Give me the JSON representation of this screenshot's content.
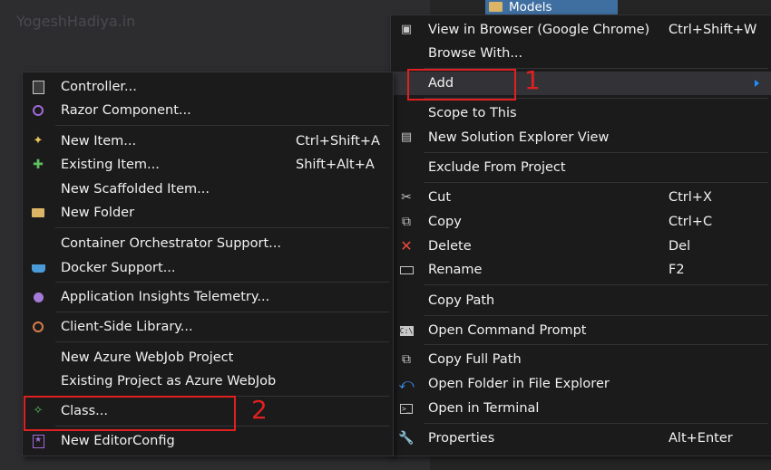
{
  "watermark": "YogeshHadiya.in",
  "solution_explorer": {
    "selected_item": "Models"
  },
  "context_menu": {
    "items": [
      {
        "label": "View in Browser (Google Chrome)",
        "shortcut": "Ctrl+Shift+W",
        "icon": "browser-icon"
      },
      {
        "label": "Browse With...",
        "shortcut": "",
        "icon": ""
      },
      {
        "label": "Add",
        "shortcut": "",
        "icon": "",
        "submenu": true
      },
      {
        "label": "Scope to This",
        "shortcut": "",
        "icon": ""
      },
      {
        "label": "New Solution Explorer View",
        "shortcut": "",
        "icon": "solution-explorer-icon"
      },
      {
        "label": "Exclude From Project",
        "shortcut": "",
        "icon": ""
      },
      {
        "label": "Cut",
        "shortcut": "Ctrl+X",
        "icon": "scissors-icon"
      },
      {
        "label": "Copy",
        "shortcut": "Ctrl+C",
        "icon": "copy-icon"
      },
      {
        "label": "Delete",
        "shortcut": "Del",
        "icon": "delete-icon"
      },
      {
        "label": "Rename",
        "shortcut": "F2",
        "icon": "rename-icon"
      },
      {
        "label": "Copy Path",
        "shortcut": "",
        "icon": ""
      },
      {
        "label": "Open Command Prompt",
        "shortcut": "",
        "icon": "command-prompt-icon"
      },
      {
        "label": "Copy Full Path",
        "shortcut": "",
        "icon": ""
      },
      {
        "label": "Open Folder in File Explorer",
        "shortcut": "",
        "icon": "refresh-arrow-icon"
      },
      {
        "label": "Open in Terminal",
        "shortcut": "",
        "icon": "terminal-icon"
      },
      {
        "label": "Properties",
        "shortcut": "Alt+Enter",
        "icon": "wrench-icon"
      }
    ]
  },
  "add_submenu": {
    "items": [
      {
        "label": "Controller...",
        "shortcut": "",
        "icon": "controller-icon"
      },
      {
        "label": "Razor Component...",
        "shortcut": "",
        "icon": "razor-icon"
      },
      {
        "label": "New Item...",
        "shortcut": "Ctrl+Shift+A",
        "icon": "new-item-icon"
      },
      {
        "label": "Existing Item...",
        "shortcut": "Shift+Alt+A",
        "icon": "existing-item-icon"
      },
      {
        "label": "New Scaffolded Item...",
        "shortcut": "",
        "icon": ""
      },
      {
        "label": "New Folder",
        "shortcut": "",
        "icon": "new-folder-icon"
      },
      {
        "label": "Container Orchestrator Support...",
        "shortcut": "",
        "icon": ""
      },
      {
        "label": "Docker Support...",
        "shortcut": "",
        "icon": "docker-icon"
      },
      {
        "label": "Application Insights Telemetry...",
        "shortcut": "",
        "icon": "insights-icon"
      },
      {
        "label": "Client-Side Library...",
        "shortcut": "",
        "icon": "library-icon"
      },
      {
        "label": "New Azure WebJob Project",
        "shortcut": "",
        "icon": ""
      },
      {
        "label": "Existing Project as Azure WebJob",
        "shortcut": "",
        "icon": ""
      },
      {
        "label": "Class...",
        "shortcut": "",
        "icon": "class-icon"
      },
      {
        "label": "New EditorConfig",
        "shortcut": "",
        "icon": "editorconfig-icon"
      }
    ]
  },
  "annotations": {
    "step1": "1",
    "step2": "2"
  },
  "colors": {
    "menu_bg": "#1b1b1c",
    "highlight": "#e02020",
    "accent": "#1e90ff"
  }
}
